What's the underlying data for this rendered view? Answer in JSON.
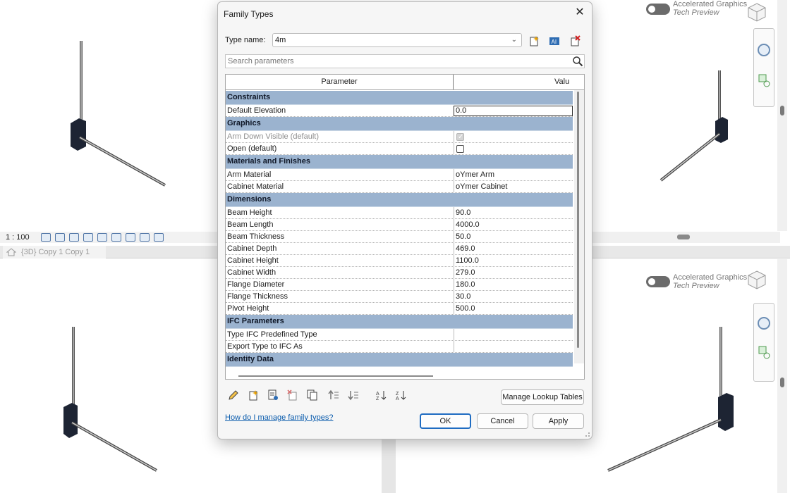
{
  "dialog": {
    "title": "Family Types",
    "close_glyph": "✕",
    "type_name_label": "Type name:",
    "type_name_value": "4m",
    "search_placeholder": "Search parameters",
    "columns": {
      "parameter": "Parameter",
      "value": "Valu"
    },
    "groups": [
      {
        "name": "Constraints",
        "rows": [
          {
            "param": "Default Elevation",
            "value": "0.0",
            "kind": "edit"
          }
        ]
      },
      {
        "name": "Graphics",
        "rows": [
          {
            "param": "Arm Down Visible (default)",
            "value": "",
            "kind": "check",
            "checked": true,
            "disabled": true
          },
          {
            "param": "Open (default)",
            "value": "",
            "kind": "check",
            "checked": false
          }
        ]
      },
      {
        "name": "Materials and Finishes",
        "rows": [
          {
            "param": "Arm Material",
            "value": "oYmer Arm"
          },
          {
            "param": "Cabinet Material",
            "value": "oYmer Cabinet"
          }
        ]
      },
      {
        "name": "Dimensions",
        "rows": [
          {
            "param": "Beam Height",
            "value": "90.0"
          },
          {
            "param": "Beam Length",
            "value": "4000.0"
          },
          {
            "param": "Beam Thickness",
            "value": "50.0"
          },
          {
            "param": "Cabinet Depth",
            "value": "469.0"
          },
          {
            "param": "Cabinet Height",
            "value": "1100.0"
          },
          {
            "param": "Cabinet Width",
            "value": "279.0"
          },
          {
            "param": "Flange Diameter",
            "value": "180.0"
          },
          {
            "param": "Flange Thickness",
            "value": "30.0"
          },
          {
            "param": "Pivot Height",
            "value": "500.0"
          }
        ]
      },
      {
        "name": "IFC Parameters",
        "rows": [
          {
            "param": "Type IFC Predefined Type",
            "value": ""
          },
          {
            "param": "Export Type to IFC As",
            "value": ""
          }
        ]
      },
      {
        "name": "Identity Data",
        "rows": []
      }
    ],
    "manage_lookup_label": "Manage Lookup Tables",
    "help_link": "How do I manage family types?",
    "ok_label": "OK",
    "cancel_label": "Cancel",
    "apply_label": "Apply"
  },
  "background": {
    "accelerated_graphics": "Accelerated Graphics",
    "tech_preview": "Tech Preview",
    "scale": "1 : 100",
    "view_tab": "{3D} Copy 1 Copy 1",
    "top_left_partial": "Accelerated Graphics"
  },
  "colors": {
    "group_header": "#9bb3cf",
    "accent": "#1f6cc2",
    "link": "#0b5cad"
  }
}
